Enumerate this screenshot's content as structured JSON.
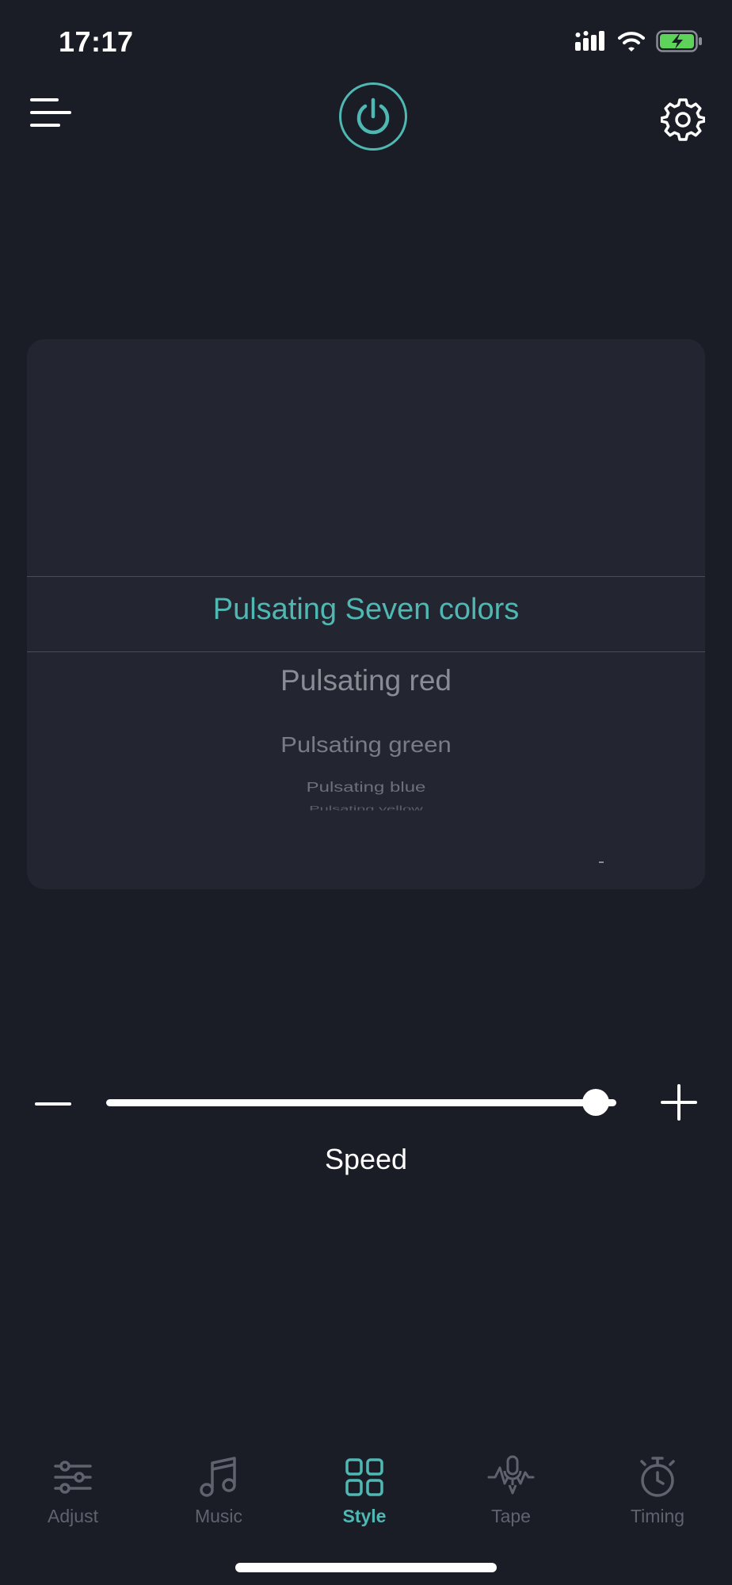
{
  "status_bar": {
    "time": "17:17"
  },
  "icons": {
    "menu": "menu-icon",
    "power": "power-icon",
    "settings": "gear-icon",
    "signal": "signal-icon",
    "wifi": "wifi-icon",
    "battery": "battery-charging-icon"
  },
  "colors": {
    "background": "#1a1c26",
    "card": "#232631",
    "accent": "#4fb8b3",
    "inactive": "#60636e",
    "battery_green": "#5ed35a"
  },
  "picker": {
    "selected": "Pulsating Seven colors",
    "items": [
      "Pulsating red",
      "Pulsating green",
      "Pulsating blue",
      "Pulsating yellow"
    ]
  },
  "speed": {
    "label": "Speed",
    "value_fraction": 0.96
  },
  "tabs": [
    {
      "label": "Adjust",
      "icon": "sliders-icon",
      "active": false
    },
    {
      "label": "Music",
      "icon": "music-note-icon",
      "active": false
    },
    {
      "label": "Style",
      "icon": "grid-icon",
      "active": true
    },
    {
      "label": "Tape",
      "icon": "microphone-wave-icon",
      "active": false
    },
    {
      "label": "Timing",
      "icon": "stopwatch-icon",
      "active": false
    }
  ]
}
